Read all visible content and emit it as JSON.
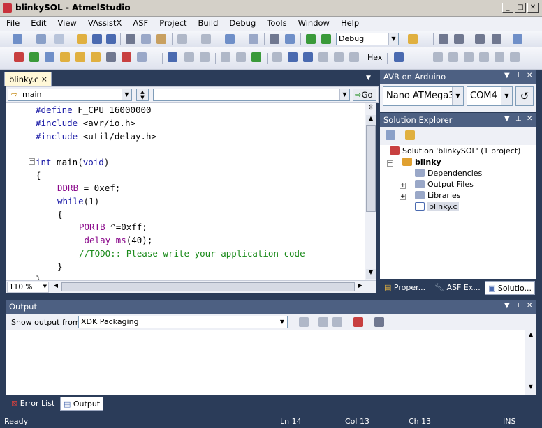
{
  "window": {
    "title": "blinkySOL - AtmelStudio"
  },
  "menu": [
    "File",
    "Edit",
    "View",
    "VAssistX",
    "ASF",
    "Project",
    "Build",
    "Debug",
    "Tools",
    "Window",
    "Help"
  ],
  "toolbar": {
    "config_value": "Debug",
    "hex_label": "Hex"
  },
  "editor": {
    "tab_label": "blinky.c",
    "tab_close": "×",
    "nav_scope": "main",
    "go_label": "Go",
    "zoom": "110 %",
    "code": {
      "l1a": "#define",
      "l1b": " F_CPU 16000000",
      "l2a": "#include",
      "l2b": " <avr/io.h>",
      "l3a": "#include",
      "l3b": " <util/delay.h>",
      "l5a": "int",
      "l5b": " main(",
      "l5c": "void",
      "l5d": ")",
      "l6": "{",
      "l7a": "DDRB",
      "l7b": " = 0xef;",
      "l8a": "while",
      "l8b": "(1)",
      "l9": "{",
      "l10a": "PORTB",
      "l10b": " ^=0xff;",
      "l11a": "_delay_ms",
      "l11b": "(40);",
      "l12": "//TODO:: Please write your application code",
      "l13": "}",
      "l14": "}"
    }
  },
  "avr_panel": {
    "title": "AVR on Arduino",
    "board": "Nano ATMega3",
    "port": "COM4",
    "refresh": "↺"
  },
  "solution_explorer": {
    "title": "Solution Explorer",
    "solution": "Solution 'blinkySOL' (1 project)",
    "project": "blinky",
    "items": [
      "Dependencies",
      "Output Files",
      "Libraries",
      "blinky.c"
    ],
    "tabs": [
      "Proper...",
      "ASF Ex...",
      "Solutio..."
    ]
  },
  "output": {
    "title": "Output",
    "show_label": "Show output from:",
    "source": "XDK Packaging",
    "tabs": [
      "Error List",
      "Output"
    ]
  },
  "status": {
    "ready": "Ready",
    "ln": "Ln 14",
    "col": "Col 13",
    "ch": "Ch 13",
    "ins": "INS"
  },
  "colors": {
    "accent": "#2b3c59",
    "panel_title": "#4d6082",
    "keyword": "#1a1aa6",
    "identifier": "#8b0a8b",
    "comment": "#1a8a1a"
  }
}
